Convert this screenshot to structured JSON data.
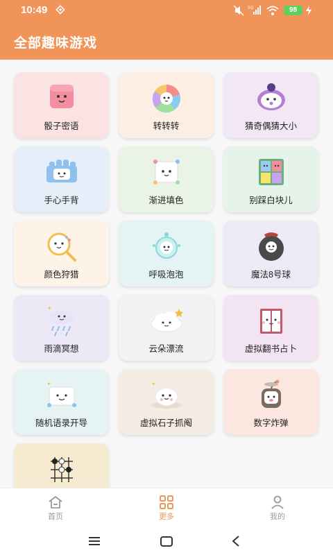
{
  "status": {
    "time": "10:49",
    "battery": "98",
    "network": "5G"
  },
  "header": {
    "title": "全部趣味游戏"
  },
  "games": [
    {
      "label": "骰子密语",
      "icon": "dice-icon",
      "bg": "#fbe3e3"
    },
    {
      "label": "转转转",
      "icon": "spinner-wheel-icon",
      "bg": "#fdeee3"
    },
    {
      "label": "猜奇偶猜大小",
      "icon": "odd-even-icon",
      "bg": "#f1e7f5"
    },
    {
      "label": "手心手背",
      "icon": "hands-icon",
      "bg": "#e6eef9"
    },
    {
      "label": "渐进填色",
      "icon": "fill-color-icon",
      "bg": "#eaf4e6"
    },
    {
      "label": "别踩白块儿",
      "icon": "tiles-icon",
      "bg": "#e5f3ea"
    },
    {
      "label": "颜色狩猎",
      "icon": "magnifier-icon",
      "bg": "#fdf3e6"
    },
    {
      "label": "呼吸泡泡",
      "icon": "bubble-icon",
      "bg": "#e4f3f3"
    },
    {
      "label": "魔法8号球",
      "icon": "magic-ball-icon",
      "bg": "#eceaf5"
    },
    {
      "label": "雨滴冥想",
      "icon": "rain-cloud-icon",
      "bg": "#ece8f6"
    },
    {
      "label": "云朵漂流",
      "icon": "cloud-icon",
      "bg": "#f2f2f2"
    },
    {
      "label": "虚拟翻书占卜",
      "icon": "book-icon",
      "bg": "#f3e4f3"
    },
    {
      "label": "随机语录开导",
      "icon": "quote-icon",
      "bg": "#e5f4f2"
    },
    {
      "label": "虚拟石子抓阄",
      "icon": "stone-icon",
      "bg": "#f5ece3"
    },
    {
      "label": "数字炸弹",
      "icon": "bomb-icon",
      "bg": "#fbe6e0"
    },
    {
      "label": "",
      "icon": "go-board-icon",
      "bg": "#f6ead0"
    }
  ],
  "nav": [
    {
      "label": "首页",
      "icon": "home-icon",
      "active": false
    },
    {
      "label": "更多",
      "icon": "grid-icon",
      "active": true
    },
    {
      "label": "我的",
      "icon": "user-icon",
      "active": false
    }
  ],
  "colors": {
    "accent": "#f0945a",
    "header": "#f0945a"
  }
}
